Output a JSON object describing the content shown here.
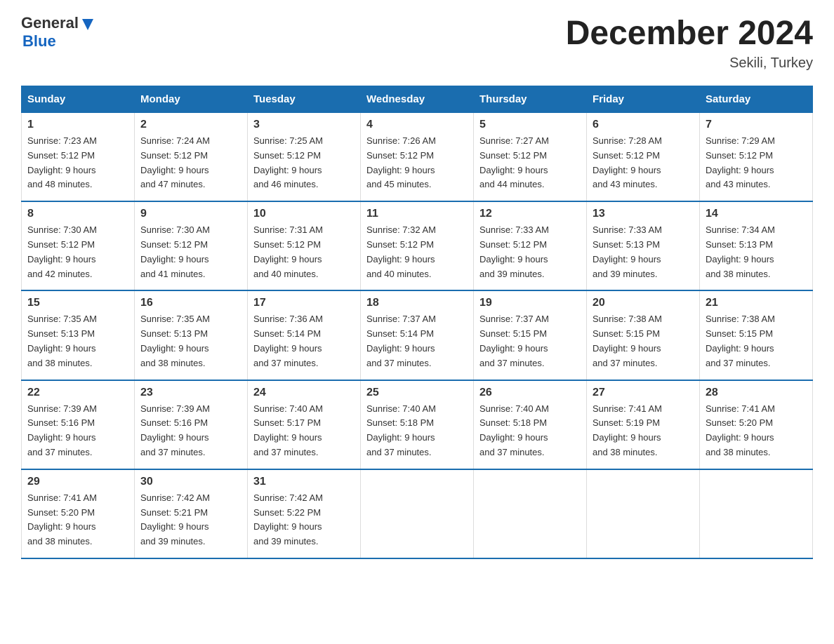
{
  "header": {
    "logo_text_general": "General",
    "logo_text_blue": "Blue",
    "title": "December 2024",
    "subtitle": "Sekili, Turkey"
  },
  "days_of_week": [
    "Sunday",
    "Monday",
    "Tuesday",
    "Wednesday",
    "Thursday",
    "Friday",
    "Saturday"
  ],
  "weeks": [
    [
      {
        "day": "1",
        "sunrise": "7:23 AM",
        "sunset": "5:12 PM",
        "daylight": "9 hours and 48 minutes."
      },
      {
        "day": "2",
        "sunrise": "7:24 AM",
        "sunset": "5:12 PM",
        "daylight": "9 hours and 47 minutes."
      },
      {
        "day": "3",
        "sunrise": "7:25 AM",
        "sunset": "5:12 PM",
        "daylight": "9 hours and 46 minutes."
      },
      {
        "day": "4",
        "sunrise": "7:26 AM",
        "sunset": "5:12 PM",
        "daylight": "9 hours and 45 minutes."
      },
      {
        "day": "5",
        "sunrise": "7:27 AM",
        "sunset": "5:12 PM",
        "daylight": "9 hours and 44 minutes."
      },
      {
        "day": "6",
        "sunrise": "7:28 AM",
        "sunset": "5:12 PM",
        "daylight": "9 hours and 43 minutes."
      },
      {
        "day": "7",
        "sunrise": "7:29 AM",
        "sunset": "5:12 PM",
        "daylight": "9 hours and 43 minutes."
      }
    ],
    [
      {
        "day": "8",
        "sunrise": "7:30 AM",
        "sunset": "5:12 PM",
        "daylight": "9 hours and 42 minutes."
      },
      {
        "day": "9",
        "sunrise": "7:30 AM",
        "sunset": "5:12 PM",
        "daylight": "9 hours and 41 minutes."
      },
      {
        "day": "10",
        "sunrise": "7:31 AM",
        "sunset": "5:12 PM",
        "daylight": "9 hours and 40 minutes."
      },
      {
        "day": "11",
        "sunrise": "7:32 AM",
        "sunset": "5:12 PM",
        "daylight": "9 hours and 40 minutes."
      },
      {
        "day": "12",
        "sunrise": "7:33 AM",
        "sunset": "5:12 PM",
        "daylight": "9 hours and 39 minutes."
      },
      {
        "day": "13",
        "sunrise": "7:33 AM",
        "sunset": "5:13 PM",
        "daylight": "9 hours and 39 minutes."
      },
      {
        "day": "14",
        "sunrise": "7:34 AM",
        "sunset": "5:13 PM",
        "daylight": "9 hours and 38 minutes."
      }
    ],
    [
      {
        "day": "15",
        "sunrise": "7:35 AM",
        "sunset": "5:13 PM",
        "daylight": "9 hours and 38 minutes."
      },
      {
        "day": "16",
        "sunrise": "7:35 AM",
        "sunset": "5:13 PM",
        "daylight": "9 hours and 38 minutes."
      },
      {
        "day": "17",
        "sunrise": "7:36 AM",
        "sunset": "5:14 PM",
        "daylight": "9 hours and 37 minutes."
      },
      {
        "day": "18",
        "sunrise": "7:37 AM",
        "sunset": "5:14 PM",
        "daylight": "9 hours and 37 minutes."
      },
      {
        "day": "19",
        "sunrise": "7:37 AM",
        "sunset": "5:15 PM",
        "daylight": "9 hours and 37 minutes."
      },
      {
        "day": "20",
        "sunrise": "7:38 AM",
        "sunset": "5:15 PM",
        "daylight": "9 hours and 37 minutes."
      },
      {
        "day": "21",
        "sunrise": "7:38 AM",
        "sunset": "5:15 PM",
        "daylight": "9 hours and 37 minutes."
      }
    ],
    [
      {
        "day": "22",
        "sunrise": "7:39 AM",
        "sunset": "5:16 PM",
        "daylight": "9 hours and 37 minutes."
      },
      {
        "day": "23",
        "sunrise": "7:39 AM",
        "sunset": "5:16 PM",
        "daylight": "9 hours and 37 minutes."
      },
      {
        "day": "24",
        "sunrise": "7:40 AM",
        "sunset": "5:17 PM",
        "daylight": "9 hours and 37 minutes."
      },
      {
        "day": "25",
        "sunrise": "7:40 AM",
        "sunset": "5:18 PM",
        "daylight": "9 hours and 37 minutes."
      },
      {
        "day": "26",
        "sunrise": "7:40 AM",
        "sunset": "5:18 PM",
        "daylight": "9 hours and 37 minutes."
      },
      {
        "day": "27",
        "sunrise": "7:41 AM",
        "sunset": "5:19 PM",
        "daylight": "9 hours and 38 minutes."
      },
      {
        "day": "28",
        "sunrise": "7:41 AM",
        "sunset": "5:20 PM",
        "daylight": "9 hours and 38 minutes."
      }
    ],
    [
      {
        "day": "29",
        "sunrise": "7:41 AM",
        "sunset": "5:20 PM",
        "daylight": "9 hours and 38 minutes."
      },
      {
        "day": "30",
        "sunrise": "7:42 AM",
        "sunset": "5:21 PM",
        "daylight": "9 hours and 39 minutes."
      },
      {
        "day": "31",
        "sunrise": "7:42 AM",
        "sunset": "5:22 PM",
        "daylight": "9 hours and 39 minutes."
      },
      null,
      null,
      null,
      null
    ]
  ],
  "labels": {
    "sunrise": "Sunrise:",
    "sunset": "Sunset:",
    "daylight": "Daylight:"
  }
}
